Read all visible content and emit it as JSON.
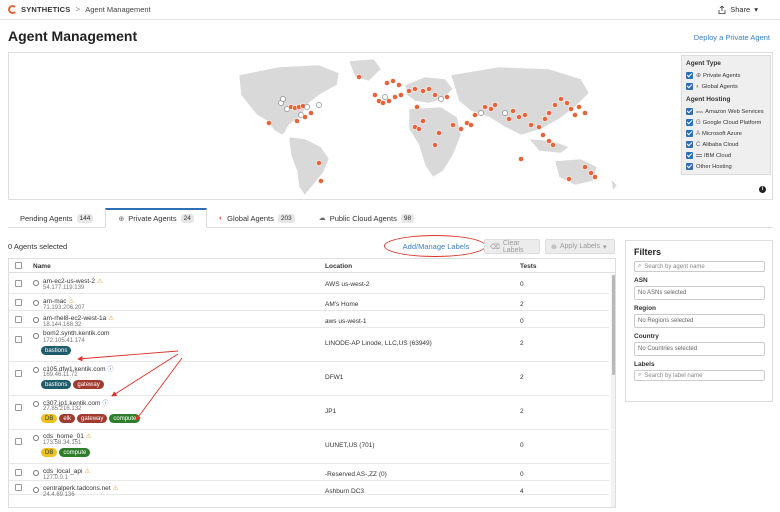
{
  "header": {
    "brand": "SYNTHETICS",
    "breadcrumb_sep": ">",
    "breadcrumb": "Agent Management",
    "share": "Share",
    "share_icon": "share-icon"
  },
  "page": {
    "title": "Agent Management",
    "deploy_link": "Deploy a Private Agent"
  },
  "legend": {
    "agent_type_title": "Agent Type",
    "agent_types": [
      "Private Agents",
      "Global Agents"
    ],
    "hosting_title": "Agent Hosting",
    "hosting": [
      {
        "icon": "aws",
        "label": "Amazon Web Services"
      },
      {
        "icon": "G",
        "label": "Google Cloud Platform"
      },
      {
        "icon": "A",
        "label": "Microsoft Azure"
      },
      {
        "icon": "C",
        "label": "Alibaba Cloud"
      },
      {
        "icon": "",
        "label": "IBM Cloud"
      },
      {
        "icon": "",
        "label": "Other Hosting"
      }
    ],
    "info": "i",
    "accent_color": "#e8633a"
  },
  "tabs": [
    {
      "label": "Pending Agents",
      "count": "144"
    },
    {
      "label": "Private Agents",
      "count": "24"
    },
    {
      "label": "Global Agents",
      "count": "203"
    },
    {
      "label": "Public Cloud Agents",
      "count": "98"
    }
  ],
  "toolbar": {
    "selected": "0 Agents selected",
    "add_manage": "Add/Manage Labels",
    "clear": "Clear Labels",
    "apply": "Apply Labels"
  },
  "table": {
    "headers": {
      "name": "Name",
      "location": "Location",
      "tests": "Tests"
    },
    "rows": [
      {
        "name": "am-ec2-us-west-2",
        "ip": "54.177.119.139",
        "location": "AWS us-west-2",
        "tests": "0",
        "warn": "⚠",
        "info": "",
        "labels": []
      },
      {
        "name": "am-mac",
        "ip": "71.193.206.207",
        "location": "AM's Home",
        "tests": "2",
        "warn": "⚠",
        "info": "",
        "labels": []
      },
      {
        "name": "am-rhel8-ec2-west-1a",
        "ip": "18.144.168.32",
        "location": "aws us-west-1",
        "tests": "0",
        "warn": "⚠",
        "info": "",
        "labels": []
      },
      {
        "name": "bom2.synth.kentik.com",
        "ip": "172.105.41.174",
        "location": "LINODE-AP Linode, LLC,US (63949)",
        "tests": "2",
        "warn": "",
        "info": "",
        "labels": [
          {
            "text": "bastions",
            "color": "teal"
          }
        ]
      },
      {
        "name": "c105.dfw1.kentik.com",
        "ip": "169.46.11.72",
        "location": "DFW1",
        "tests": "2",
        "warn": "",
        "info": "ⓘ",
        "labels": [
          {
            "text": "bastions",
            "color": "teal"
          },
          {
            "text": "gateway",
            "color": "red"
          }
        ]
      },
      {
        "name": "c307.jp1.kentik.com",
        "ip": "27.85.216.132",
        "location": "JP1",
        "tests": "2",
        "warn": "",
        "info": "ⓘ",
        "labels": [
          {
            "text": "DB",
            "color": "yellow"
          },
          {
            "text": "elk",
            "color": "red"
          },
          {
            "text": "gateway",
            "color": "red"
          },
          {
            "text": "compute",
            "color": "green"
          }
        ]
      },
      {
        "name": "cds_home_01",
        "ip": "173.58.34.151",
        "location": "UUNET,US (701)",
        "tests": "0",
        "warn": "⚠",
        "info": "",
        "labels": [
          {
            "text": "DB",
            "color": "yellow"
          },
          {
            "text": "compute",
            "color": "green"
          }
        ]
      },
      {
        "name": "cds_local_api",
        "ip": "127.0.0.1",
        "location": "-Reserved AS-,ZZ (0)",
        "tests": "0",
        "warn": "⚠",
        "info": "",
        "labels": []
      },
      {
        "name": "centralperk.tadcons.net",
        "ip": "24.4.69.136",
        "location": "Ashburn DC3",
        "tests": "4",
        "warn": "⚠",
        "info": "",
        "labels": []
      }
    ]
  },
  "filters": {
    "title": "Filters",
    "agent_placeholder": "Search by agent name",
    "asn_label": "ASN",
    "asn_value": "No ASNs selected",
    "region_label": "Region",
    "region_value": "No Regions selected",
    "country_label": "Country",
    "country_value": "No Countries selected",
    "labels_label": "Labels",
    "labels_placeholder": "Search by label name"
  }
}
